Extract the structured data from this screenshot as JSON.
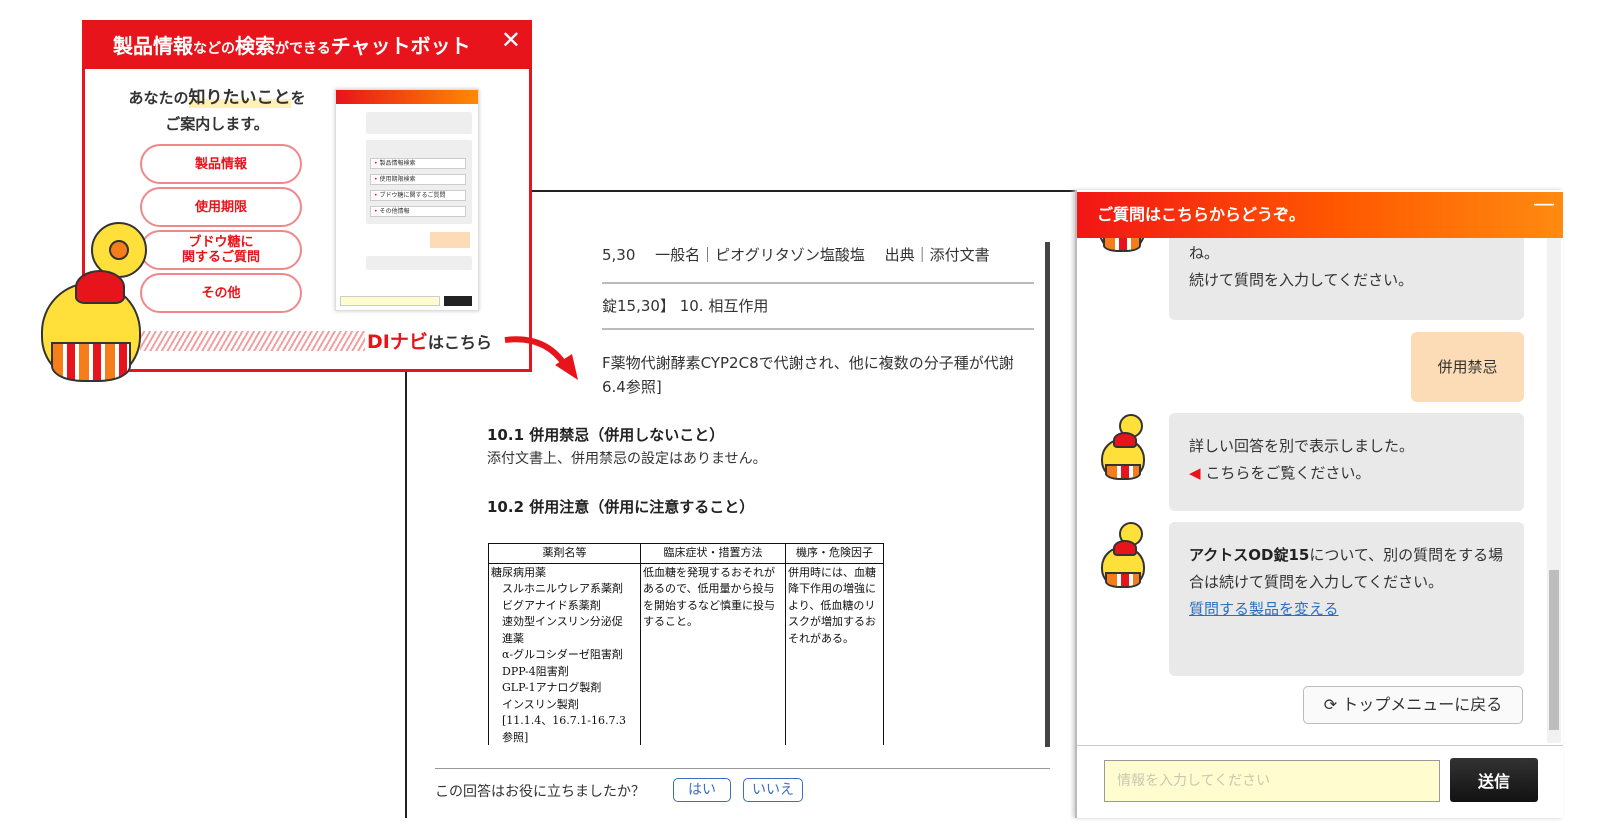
{
  "promo": {
    "title_a": "製品情報",
    "title_b": "などの",
    "title_c": "検索",
    "title_d": "ができる",
    "title_e": "チャットボット",
    "close_icon": "close-icon",
    "tagline_a": "あなたの",
    "tagline_b": "知りたいこと",
    "tagline_c": "を",
    "tagline_d": "ご案内します。",
    "buttons": [
      "製品情報",
      "使用期限",
      "ブドウ糖に\n関するご質問",
      "その他"
    ],
    "link_a": "DIナビ",
    "link_b": "はこちら",
    "colors": {
      "brand_red": "#e8141b",
      "orange": "#ff8a00"
    }
  },
  "document": {
    "line1": "5,30　 一般名｜ピオグリタゾン塩酸塩　 出典｜添付文書",
    "line2": "錠15,30】 10. 相互作用",
    "line3": "F薬物代謝酵素CYP2C8で代謝され、他に複数の分子種が代謝",
    "line4": "6.4参照]",
    "section1_title": "10.1 併用禁忌（併用しないこと）",
    "section1_body": "添付文書上、併用禁忌の設定はありません。",
    "section2_title": "10.2 併用注意（併用に注意すること）",
    "table": {
      "headers": [
        "薬剤名等",
        "臨床症状・措置方法",
        "機序・危険因子"
      ],
      "col1": [
        "糖尿病用薬",
        "　スルホニルウレア系薬剤",
        "　ビグアナイド系薬剤",
        "　速効型インスリン分泌促",
        "　進薬",
        "　α-グルコシダーゼ阻害剤",
        "　DPP-4阻害剤",
        "　GLP-1アナログ製剤",
        "　インスリン製剤",
        "　[11.1.4、16.7.1-16.7.3",
        "　参照]"
      ],
      "col2": [
        "低血糖を発現するおそれが",
        "あるので、低用量から投与",
        "を開始するなど慎重に投与",
        "すること。"
      ],
      "col3": [
        "併用時には、血糖",
        "降下作用の増強に",
        "より、低血糖のリ",
        "スクが増加するお",
        "それがある。"
      ]
    },
    "feedback_question": "この回答はお役に立ちましたか？",
    "feedback_yes": "はい",
    "feedback_no": "いいえ"
  },
  "chat": {
    "title": "ご質問はこちらからどうぞ。",
    "minimize_icon": "minimize-icon",
    "messages": [
      {
        "from": "bot",
        "lines": [
          "ね。",
          "続けて質問を入力してください。"
        ]
      },
      {
        "from": "user",
        "text": "併用禁忌"
      },
      {
        "from": "bot",
        "lines": [
          "詳しい回答を別で表示しました。",
          "こちらをご覧ください。"
        ]
      },
      {
        "from": "bot",
        "bold": "アクトスOD錠15",
        "text": "について、別の質問をする場合は続けて質問を入力してください。",
        "link": "質問する製品を変える"
      }
    ],
    "top_menu": "トップメニューに戻る",
    "input_placeholder": "情報を入力してください",
    "send": "送信"
  },
  "mini_preview": {
    "items": [
      "製品情報検索",
      "使用期限検索",
      "ブドウ糖に関するご質問",
      "その他情報"
    ]
  }
}
